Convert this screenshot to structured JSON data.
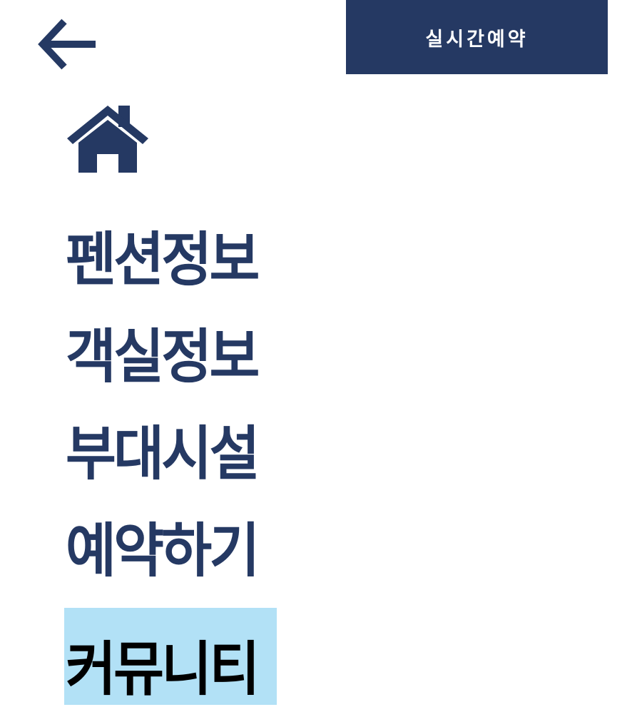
{
  "header": {
    "back_icon": "arrow-left-icon",
    "reserve_label": "실시간예약",
    "home_icon": "house-icon"
  },
  "colors": {
    "navy": "#253963",
    "active_bg": "#b2e1f6",
    "active_text": "#000000",
    "background": "#ffffff"
  },
  "menu": {
    "items": [
      {
        "label": "펜션정보",
        "active": false
      },
      {
        "label": "객실정보",
        "active": false
      },
      {
        "label": "부대시설",
        "active": false
      },
      {
        "label": "예약하기",
        "active": false
      },
      {
        "label": "커뮤니티",
        "active": true
      }
    ]
  }
}
